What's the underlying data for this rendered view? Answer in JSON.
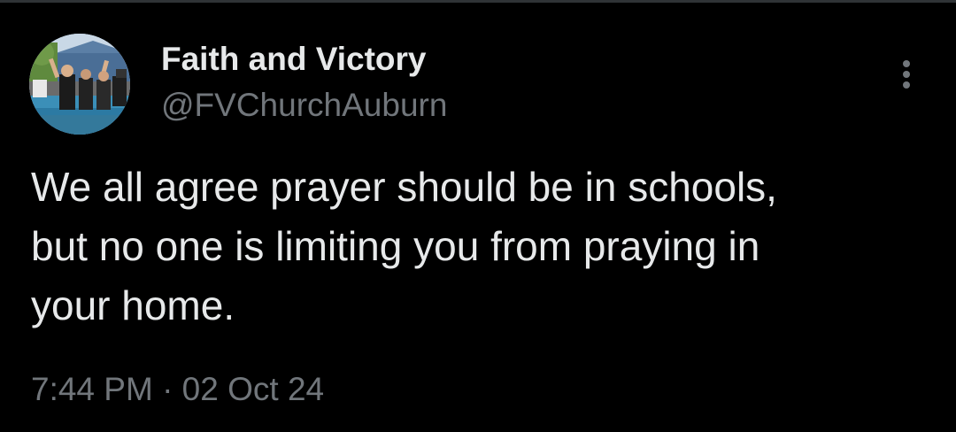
{
  "tweet": {
    "display_name": "Faith and Victory",
    "handle": "@FVChurchAuburn",
    "text": "We all agree prayer should be in schools,\nbut no one is limiting you from praying in\nyour home.",
    "timestamp": "7:44 PM · 02 Oct 24"
  },
  "icons": {
    "more": "more-options-icon",
    "avatar": "profile-photo"
  },
  "colors": {
    "background": "#000000",
    "primary_text": "#e7e9ea",
    "secondary_text": "#71767b",
    "divider": "#2f3336"
  }
}
